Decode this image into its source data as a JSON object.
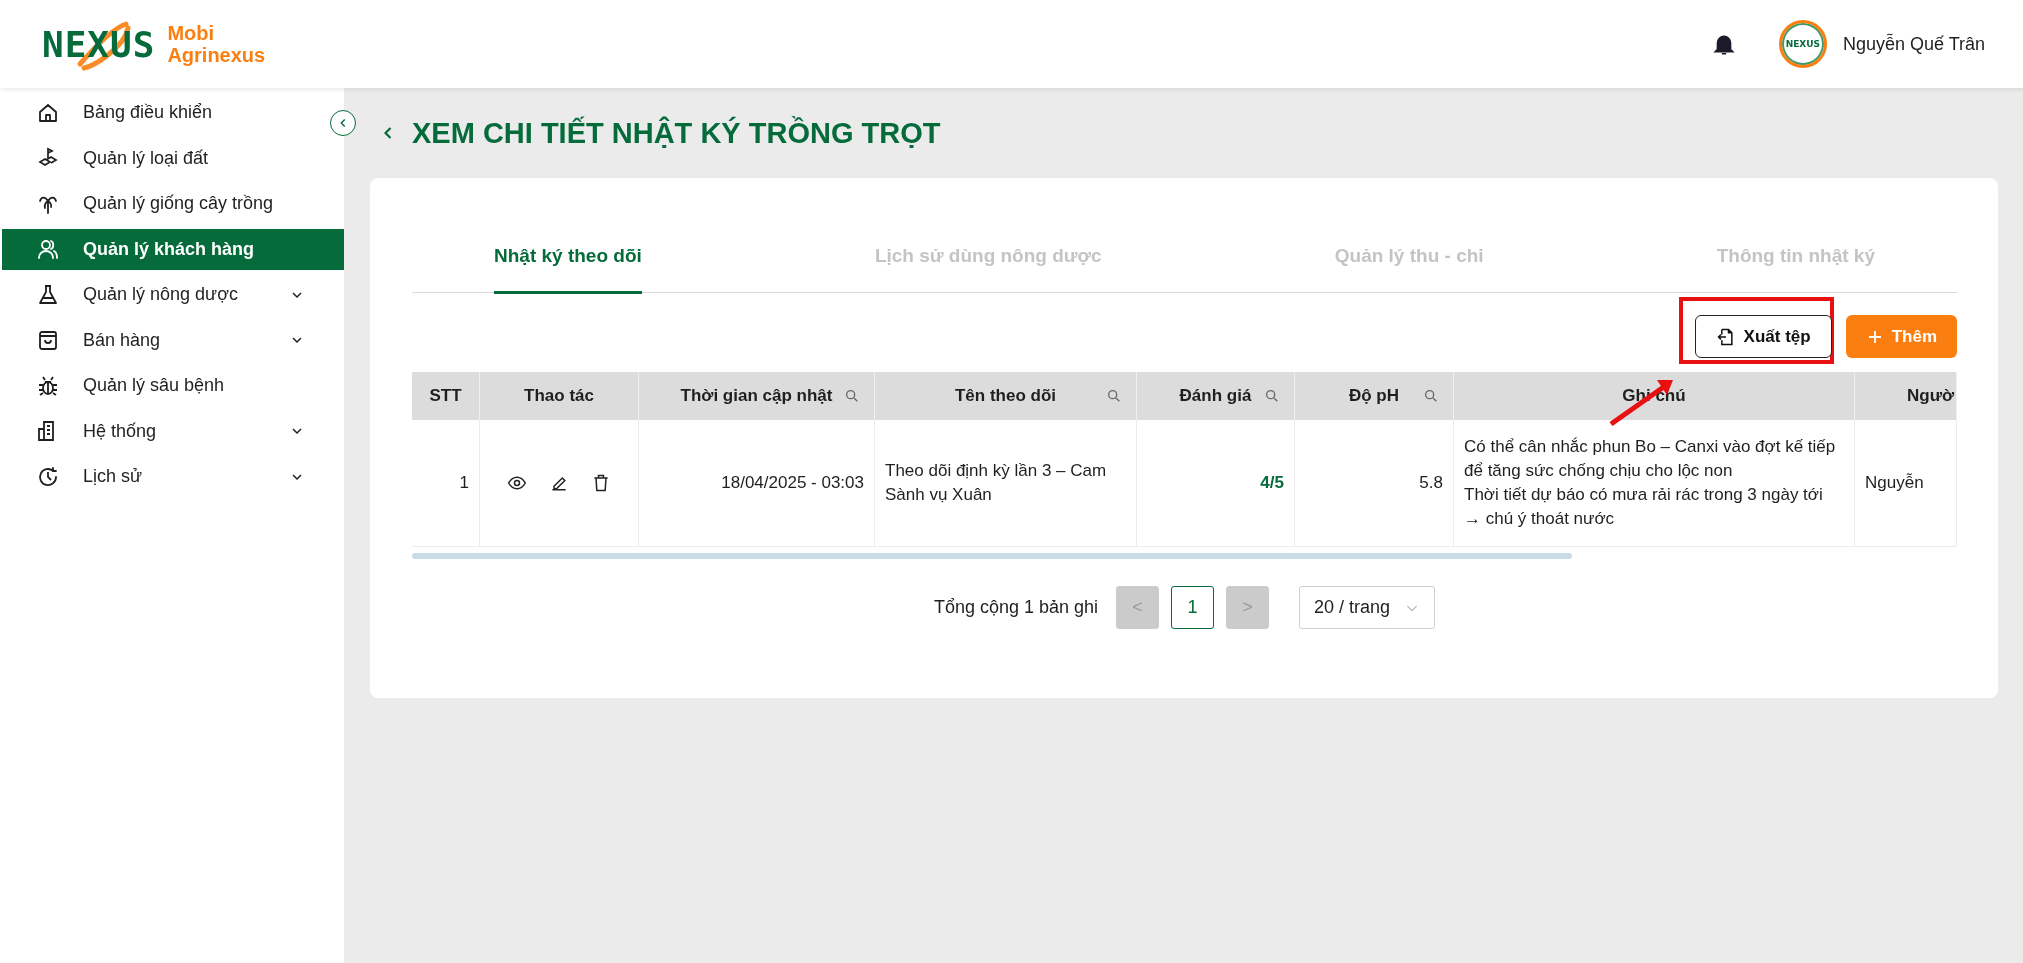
{
  "logo": {
    "mark": "NEXUS",
    "title": "Mobi",
    "subtitle": "Agrinexus"
  },
  "user": {
    "avatar_text": "NEXUS",
    "name": "Nguyễn Quế Trân"
  },
  "sidebar": {
    "items": [
      {
        "label": "Bảng điều khiển",
        "kind": "home",
        "selected": false,
        "expandable": false
      },
      {
        "label": "Quản lý loại đất",
        "kind": "soil",
        "selected": false,
        "expandable": false
      },
      {
        "label": "Quản lý giống cây trồng",
        "kind": "plant",
        "selected": false,
        "expandable": false
      },
      {
        "label": "Quản lý khách hàng",
        "kind": "users",
        "selected": true,
        "expandable": false
      },
      {
        "label": "Quản lý nông dược",
        "kind": "flask",
        "selected": false,
        "expandable": true
      },
      {
        "label": "Bán hàng",
        "kind": "bag",
        "selected": false,
        "expandable": true
      },
      {
        "label": "Quản lý sâu bệnh",
        "kind": "bug",
        "selected": false,
        "expandable": false
      },
      {
        "label": "Hệ thống",
        "kind": "building",
        "selected": false,
        "expandable": true
      },
      {
        "label": "Lịch sử",
        "kind": "clock",
        "selected": false,
        "expandable": true
      }
    ]
  },
  "page": {
    "title": "XEM CHI TIẾT NHẬT KÝ TRỒNG TRỌT"
  },
  "tabs": [
    {
      "label": "Nhật ký theo dõi",
      "selected": true
    },
    {
      "label": "Lịch sử dùng nông dược",
      "selected": false
    },
    {
      "label": "Quản lý thu - chi",
      "selected": false
    },
    {
      "label": "Thông tin nhật ký",
      "selected": false
    }
  ],
  "toolbar": {
    "buttons": [
      {
        "label": "Xuất tệp",
        "kind": "export",
        "highlighted": true
      },
      {
        "label": "Thêm",
        "kind": "add",
        "highlighted": false
      }
    ]
  },
  "table": {
    "columns": [
      {
        "label": "STT",
        "searchable": false
      },
      {
        "label": "Thao tác",
        "searchable": false
      },
      {
        "label": "Thời gian cập nhật",
        "searchable": true
      },
      {
        "label": "Tên theo dõi",
        "searchable": true
      },
      {
        "label": "Đánh giá",
        "searchable": true
      },
      {
        "label": "Độ pH",
        "searchable": true
      },
      {
        "label": "Ghi chú",
        "searchable": false
      },
      {
        "label": "Ngườ",
        "searchable": false
      }
    ],
    "rows": [
      {
        "stt": "1",
        "actions": [
          {
            "kind": "view"
          },
          {
            "kind": "edit"
          },
          {
            "kind": "delete"
          }
        ],
        "updated": "18/04/2025 - 03:03",
        "name": "Theo dõi định kỳ lần 3 – Cam Sành vụ Xuân",
        "rating": "4/5",
        "ph": "5.8",
        "note": [
          "Có thể cân nhắc phun Bo – Canxi vào đợt kế tiếp để tăng sức chống chịu cho lộc non",
          "Thời tiết dự báo có mưa rải rác trong 3 ngày tới → chú ý thoát nước"
        ],
        "column_8": "Nguyễn"
      }
    ]
  },
  "pagination": {
    "total": "Tổng cộng 1 bản ghi",
    "prev_disabled": true,
    "next_disabled": true,
    "prev": "<",
    "next": ">",
    "pages": [
      {
        "label": "1",
        "selected": true
      }
    ],
    "page_size": "20 / trang"
  }
}
